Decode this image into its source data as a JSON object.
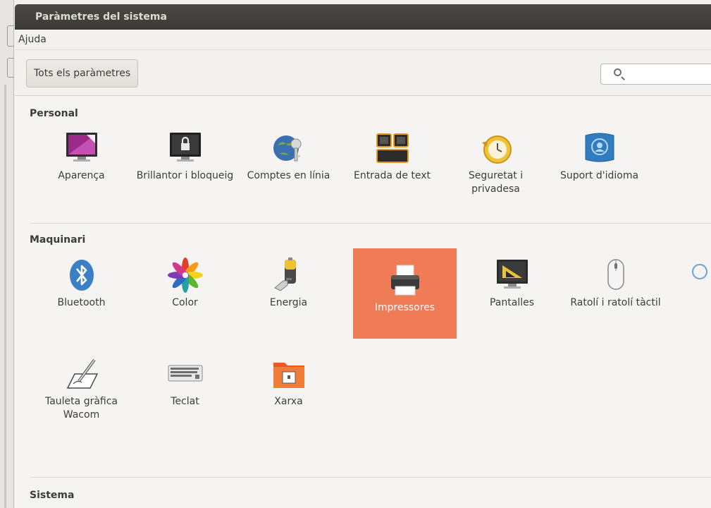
{
  "window": {
    "title": "Paràmetres del sistema"
  },
  "menubar": {
    "help": "Ajuda"
  },
  "toolbar": {
    "all_settings": "Tots els paràmetres",
    "search_placeholder": ""
  },
  "sections": {
    "personal": {
      "title": "Personal",
      "items": [
        {
          "label": "Aparença",
          "icon": "appearance-icon"
        },
        {
          "label": "Brillantor i bloqueig",
          "icon": "brightness-lock-icon"
        },
        {
          "label": "Comptes en línia",
          "icon": "online-accounts-icon"
        },
        {
          "label": "Entrada de text",
          "icon": "text-entry-icon"
        },
        {
          "label": "Seguretat i privadesa",
          "icon": "security-privacy-icon"
        },
        {
          "label": "Suport d'idioma",
          "icon": "language-support-icon"
        }
      ]
    },
    "hardware": {
      "title": "Maquinari",
      "items": [
        {
          "label": "Bluetooth",
          "icon": "bluetooth-icon"
        },
        {
          "label": "Color",
          "icon": "color-icon"
        },
        {
          "label": "Energia",
          "icon": "power-icon"
        },
        {
          "label": "Impressores",
          "icon": "printer-icon"
        },
        {
          "label": "Pantalles",
          "icon": "displays-icon"
        },
        {
          "label": "Ratolí i ratolí tàctil",
          "icon": "mouse-icon"
        },
        {
          "label": "Tauleta gràfica Wacom",
          "icon": "wacom-tablet-icon"
        },
        {
          "label": "Teclat",
          "icon": "keyboard-icon"
        },
        {
          "label": "Xarxa",
          "icon": "network-icon"
        }
      ]
    },
    "system": {
      "title": "Sistema"
    }
  },
  "colors": {
    "selection": "#f07c57",
    "titlebar": "#3b3a36"
  }
}
